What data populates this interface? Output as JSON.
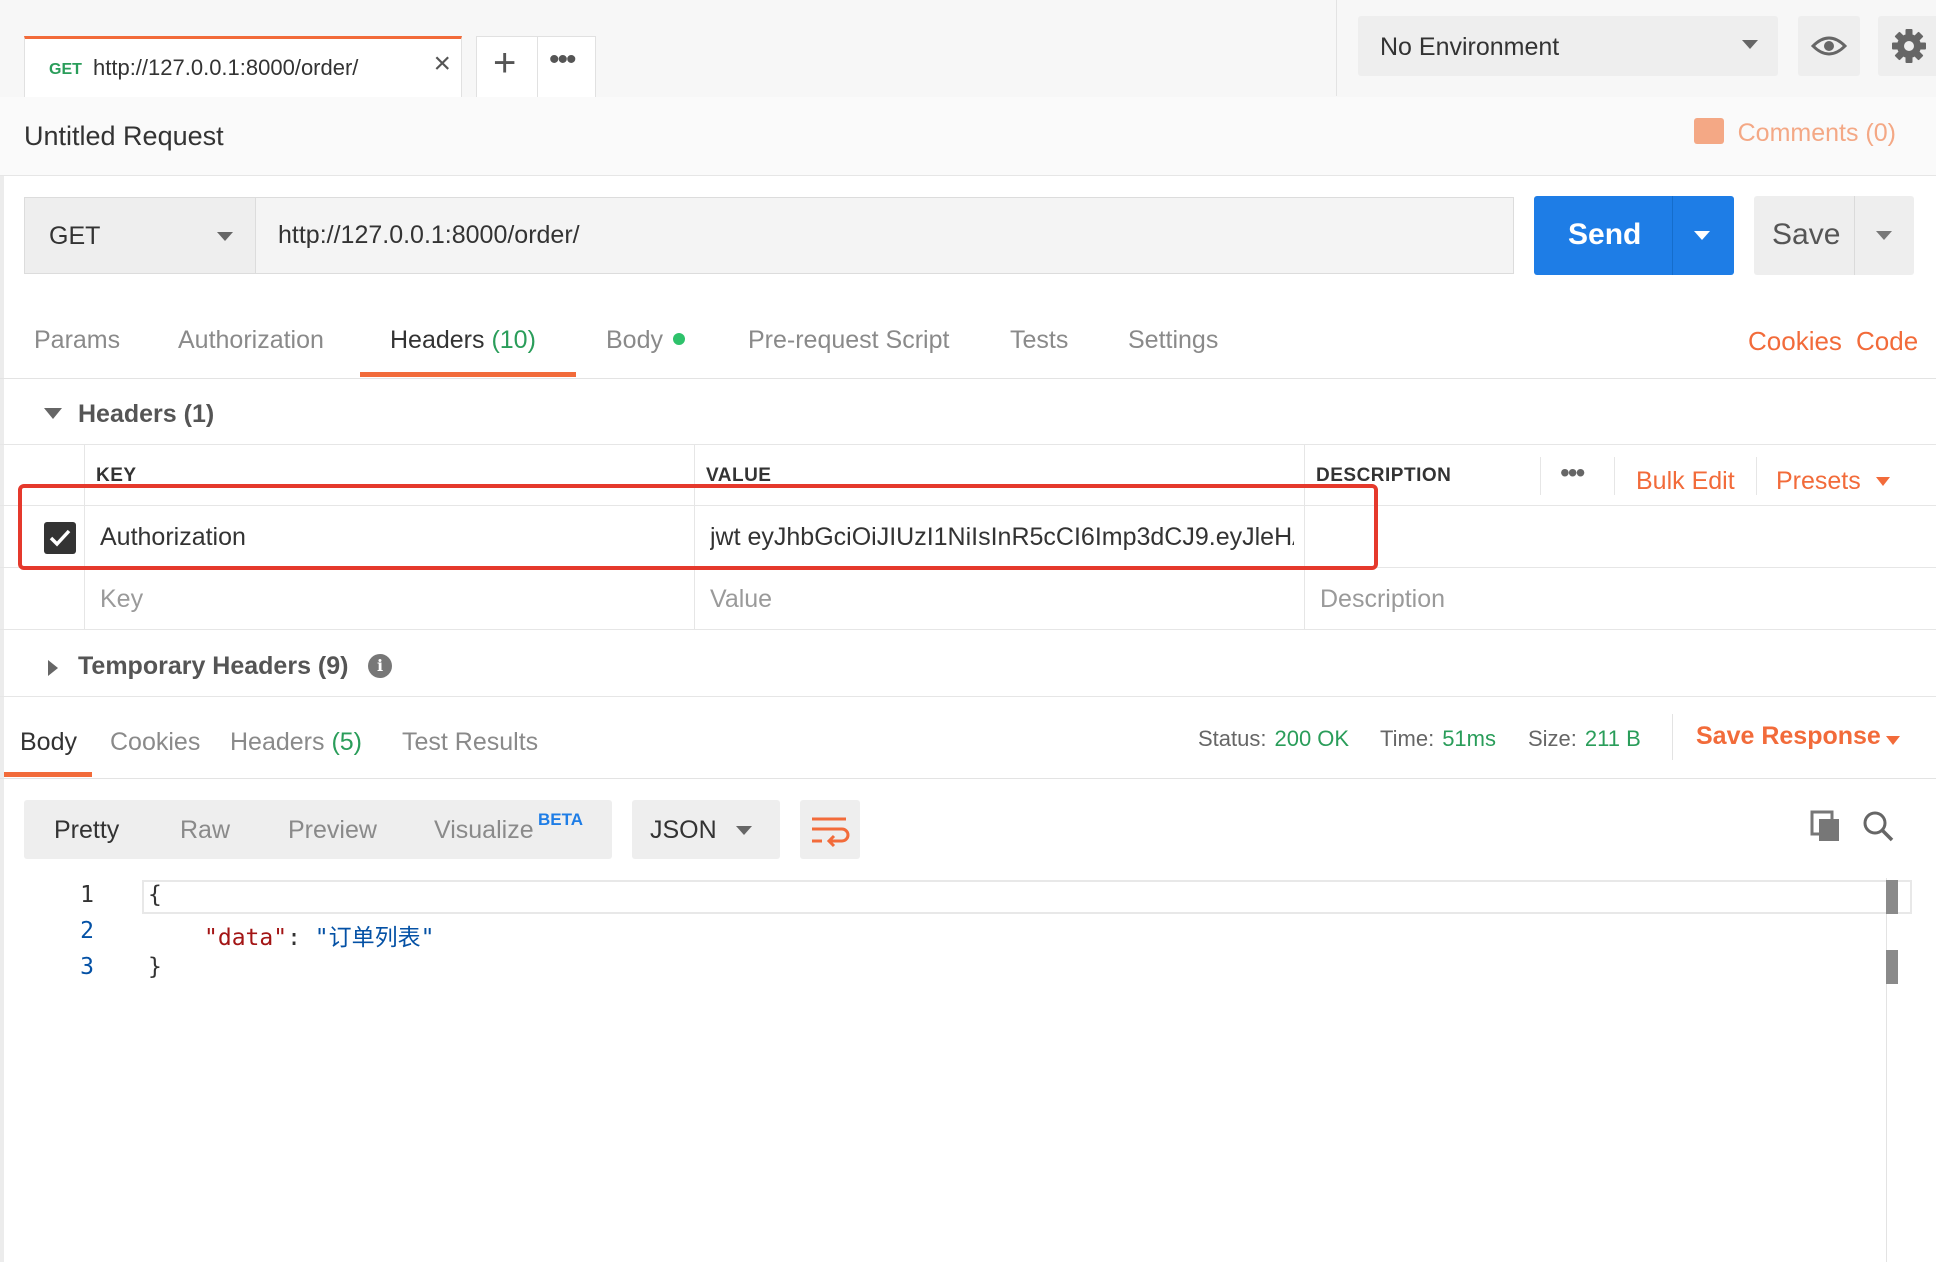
{
  "tab": {
    "method": "GET",
    "url": "http://127.0.0.1:8000/order/",
    "close": "×"
  },
  "tab_actions": {
    "new": "+",
    "more": "•••"
  },
  "environment": {
    "selected": "No Environment"
  },
  "request": {
    "title": "Untitled Request",
    "comments": "Comments (0)",
    "method": "GET",
    "url": "http://127.0.0.1:8000/order/",
    "send": "Send",
    "save": "Save"
  },
  "request_tabs": {
    "params": "Params",
    "authorization": "Authorization",
    "headers": "Headers",
    "headers_count": "(10)",
    "body": "Body",
    "pre_request": "Pre-request Script",
    "tests": "Tests",
    "settings": "Settings",
    "cookies": "Cookies",
    "code": "Code"
  },
  "headers_section": {
    "title": "Headers (1)",
    "columns": {
      "key": "KEY",
      "value": "VALUE",
      "description": "DESCRIPTION"
    },
    "more": "•••",
    "bulk_edit": "Bulk Edit",
    "presets": "Presets",
    "rows": [
      {
        "checked": true,
        "key": "Authorization",
        "value": "jwt eyJhbGciOiJIUzI1NiIsInR5cCI6Imp3dCJ9.eyJleHA...",
        "description": ""
      }
    ],
    "placeholder": {
      "key": "Key",
      "value": "Value",
      "description": "Description"
    }
  },
  "temporary_headers": {
    "title": "Temporary Headers (9)",
    "info": "i"
  },
  "response": {
    "tabs": {
      "body": "Body",
      "cookies": "Cookies",
      "headers": "Headers",
      "headers_count": "(5)",
      "test_results": "Test Results"
    },
    "status_label": "Status:",
    "status": "200 OK",
    "time_label": "Time:",
    "time": "51ms",
    "size_label": "Size:",
    "size": "211 B",
    "save_response": "Save Response",
    "views": {
      "pretty": "Pretty",
      "raw": "Raw",
      "preview": "Preview",
      "visualize": "Visualize",
      "beta": "BETA"
    },
    "format": "JSON",
    "lines": [
      "1",
      "2",
      "3"
    ],
    "code": {
      "open": "{",
      "key": "\"data\"",
      "colon": ": ",
      "value": "\"订单列表\"",
      "close": "}"
    }
  },
  "colors": {
    "accent": "#f26b3a",
    "send": "#1e7de6",
    "success": "#2a9d5a",
    "highlight": "#e5392c"
  },
  "icons": [
    "close-icon",
    "plus-icon",
    "more-icon",
    "eye-icon",
    "gear-icon",
    "comment-icon",
    "caret-down-icon",
    "check-icon",
    "info-icon",
    "wrap-icon",
    "copy-icon",
    "search-icon"
  ]
}
